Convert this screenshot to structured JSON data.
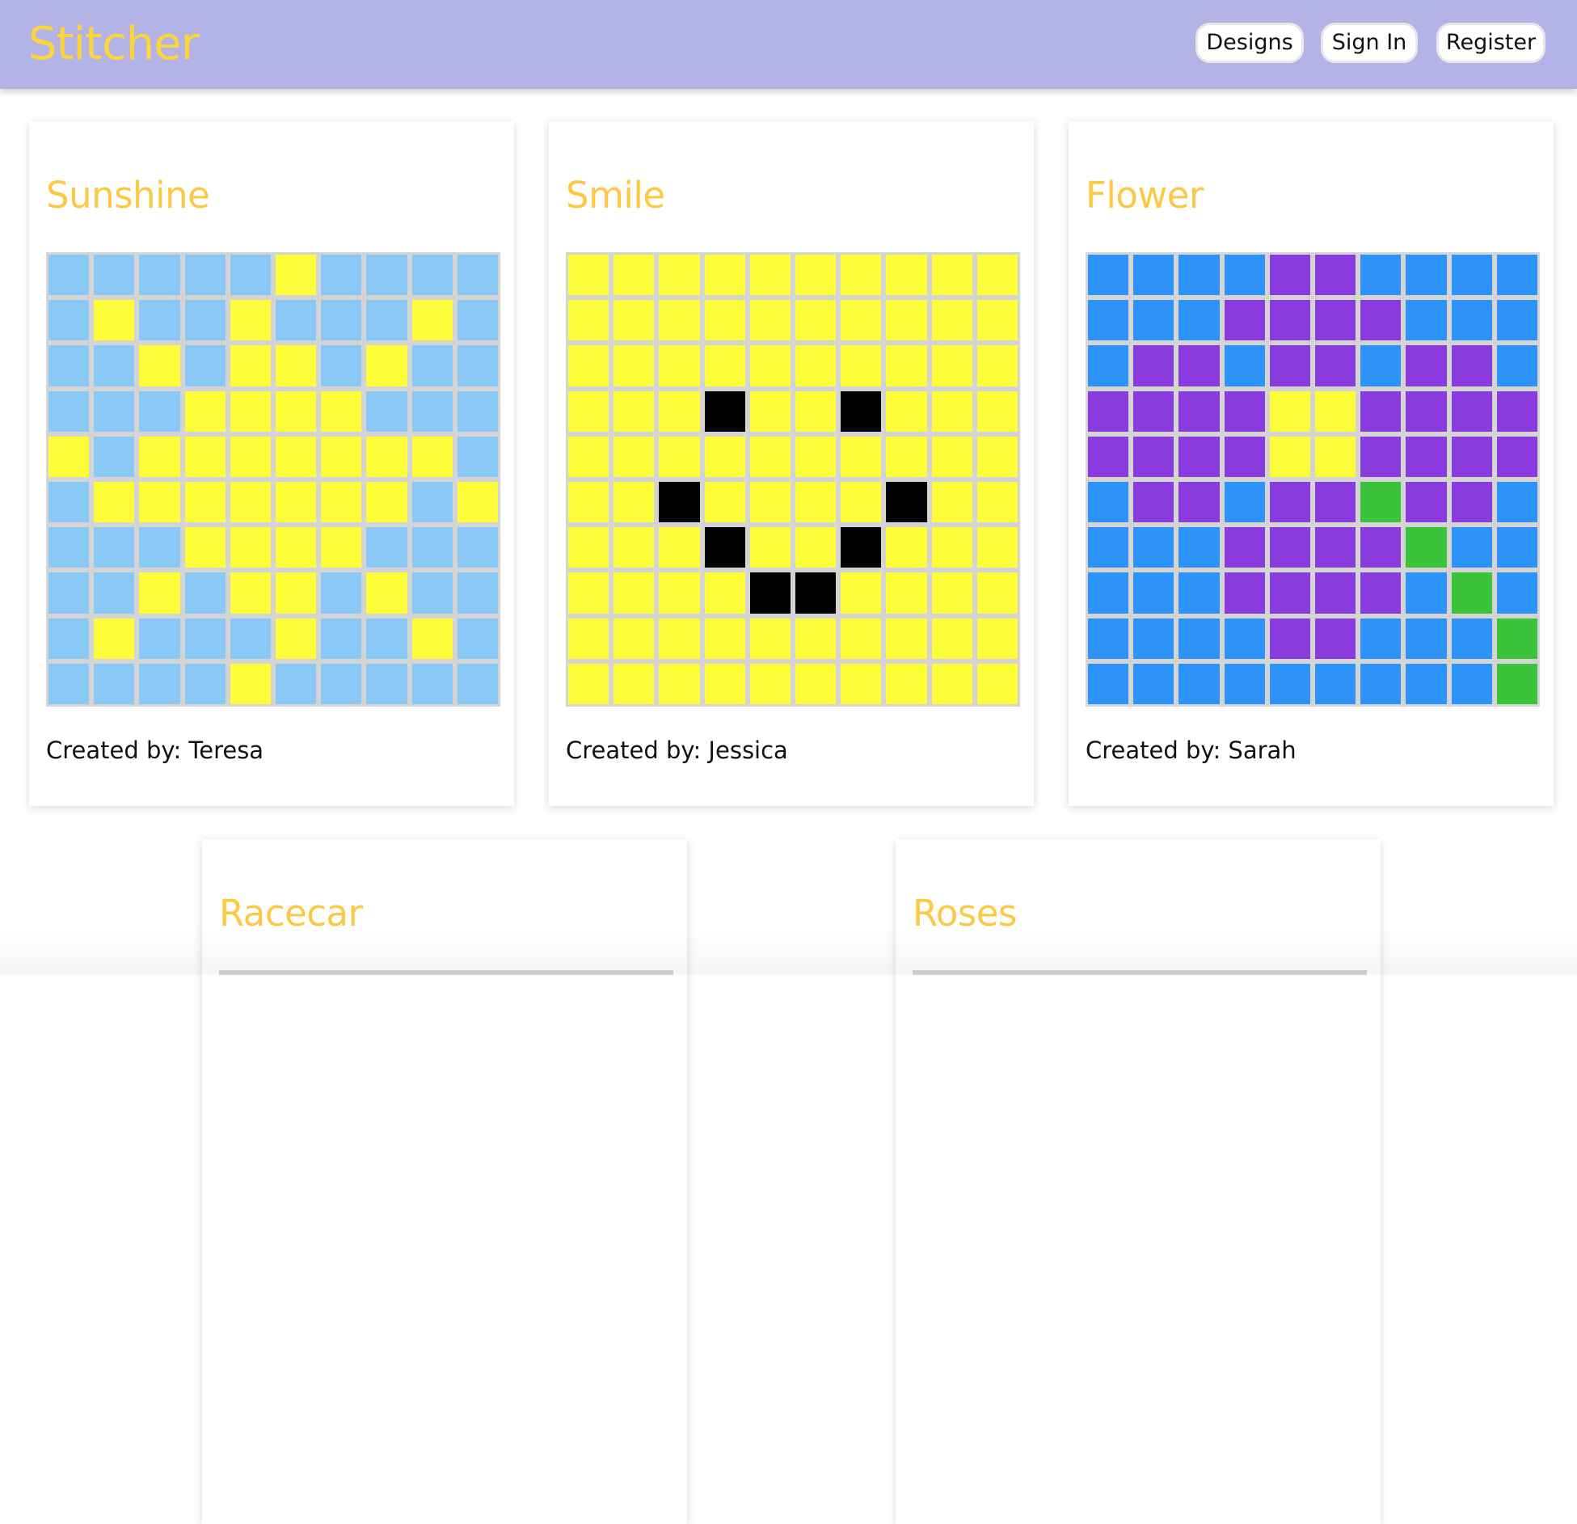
{
  "app": {
    "brand": "Stitcher",
    "nav": {
      "designs": "Designs",
      "sign_in": "Sign In",
      "register": "Register"
    }
  },
  "colors": {
    "B": "#8ac9f6",
    "Y": "#fdfd3a",
    "K": "#000000",
    "D": "#2e93f8",
    "P": "#8a3bde",
    "G": "#3cc33c",
    "brand": "#fdd53b",
    "title": "#fbc944",
    "nav_bg": "#b3b3e6",
    "grid_line": "#d4d4d4"
  },
  "designs": [
    {
      "title": "Sunshine",
      "creator": "Created by: Teresa",
      "pattern": [
        "BBBBBYBBBB",
        "BYBBYBBBYB",
        "BBYBYYBYBB",
        "BBBYYYYBBB",
        "YBYYYYYYYB",
        "BYYYYYYYBY",
        "BBBYYYYBBB",
        "BBYBYYBYBB",
        "BYBBBYBBYB",
        "BBBBYBBBBB"
      ]
    },
    {
      "title": "Smile",
      "creator": "Created by: Jessica",
      "pattern": [
        "YYYYYYYYYY",
        "YYYYYYYYYY",
        "YYYYYYYYYY",
        "YYYKYYKYYY",
        "YYYYYYYYYY",
        "YYKYYYYKYY",
        "YYYKYYKYYY",
        "YYYYKKYYYY",
        "YYYYYYYYYY",
        "YYYYYYYYYY"
      ]
    },
    {
      "title": "Flower",
      "creator": "Created by: Sarah",
      "pattern": [
        "DDDDPPDDDD",
        "DDDPPPPDDD",
        "DPPDPPDPPD",
        "PPPPYYPPPP",
        "PPPPYYPPPP",
        "DPPDPPGPPD",
        "DDDPPPPGDD",
        "DDDPPPPDGD",
        "DDDDPPDDDG",
        "DDDDDDDDDG"
      ]
    },
    {
      "title": "Racecar",
      "creator": "",
      "pattern": []
    },
    {
      "title": "Roses",
      "creator": "",
      "pattern": []
    }
  ]
}
